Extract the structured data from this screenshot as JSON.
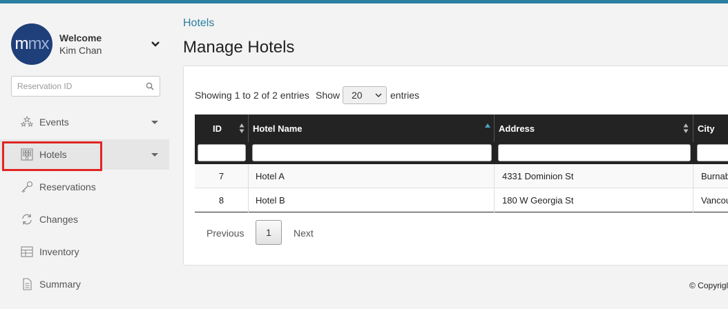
{
  "user": {
    "avatar_text_a": "m",
    "avatar_text_b": "mx",
    "welcome": "Welcome",
    "name": "Kim Chan"
  },
  "search": {
    "placeholder": "Reservation ID"
  },
  "nav": {
    "items": [
      {
        "label": "Events",
        "icon": "stars-icon"
      },
      {
        "label": "Hotels",
        "icon": "building-icon"
      },
      {
        "label": "Reservations",
        "icon": "key-icon"
      },
      {
        "label": "Changes",
        "icon": "refresh-icon"
      },
      {
        "label": "Inventory",
        "icon": "table-icon"
      },
      {
        "label": "Summary",
        "icon": "document-icon"
      }
    ]
  },
  "main": {
    "breadcrumb": "Hotels",
    "title": "Manage Hotels",
    "showing": "Showing 1 to 2 of 2 entries",
    "show_label": "Show",
    "page_size": "20",
    "entries_label": "entries"
  },
  "table": {
    "columns": [
      "ID",
      "Hotel Name",
      "Address",
      "City"
    ],
    "rows": [
      {
        "id": "7",
        "name": "Hotel A",
        "address": "4331 Dominion St",
        "city": "Burnab"
      },
      {
        "id": "8",
        "name": "Hotel B",
        "address": "180 W Georgia St",
        "city": "Vancou"
      }
    ]
  },
  "pager": {
    "previous": "Previous",
    "page": "1",
    "next": "Next"
  },
  "footer": {
    "copyright": "© Copyrigl"
  },
  "colors": {
    "accent": "#2a7fa0",
    "header_bg": "#232323",
    "highlight": "#e02424",
    "avatar_bg": "#1f3f7a"
  }
}
